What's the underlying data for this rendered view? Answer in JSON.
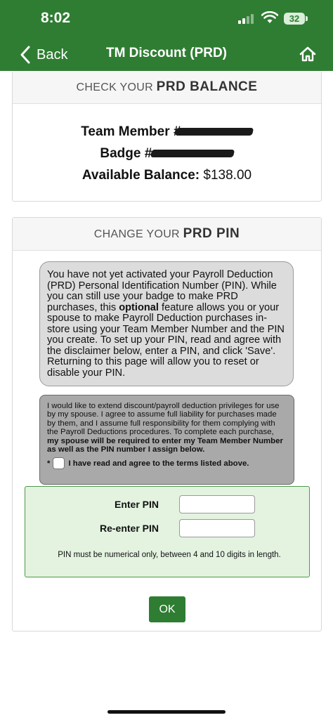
{
  "status_bar": {
    "time": "8:02",
    "battery": "32"
  },
  "nav": {
    "back_label": "Back",
    "title": "TM Discount (PRD)"
  },
  "balance": {
    "heading_prefix": "CHECK YOUR",
    "heading_bold": "PRD BALANCE",
    "team_member_label": "Team Member #:",
    "badge_label": "Badge #:",
    "available_label": "Available Balance:",
    "available_value": "$138.00"
  },
  "pin": {
    "heading_prefix": "CHANGE YOUR",
    "heading_bold": "PRD PIN",
    "info_part1": "You have not yet activated your Payroll Deduction (PRD) Personal Identification Number (PIN). While you can still use your badge to make PRD purchases, this ",
    "info_bold": "optional",
    "info_part2": " feature allows you or your spouse to make Payroll Deduction purchases in-store using your Team Member Number and the PIN you create. To set up your PIN, read and agree with the disclaimer below, enter a PIN, and click 'Save'. Returning to this page will allow you to reset or disable your PIN.",
    "disclaimer_part1": "I would like to extend discount/payroll deduction privileges for use by my spouse. I agree to assume full liability for purchases made by them, and I assume full responsibility for them complying with the Payroll Deductions procedures. To complete each purchase, ",
    "disclaimer_bold": "my spouse will be required to enter my Team Member Number as well as the PIN number I assign below.",
    "agree_star": "*",
    "agree_label": "I have read and agree to the terms listed above.",
    "enter_pin_label": "Enter PIN",
    "reenter_pin_label": "Re-enter PIN",
    "enter_pin_value": "",
    "reenter_pin_value": "",
    "pin_note": "PIN must be numerical only, between 4 and 10 digits in length.",
    "ok_label": "OK"
  }
}
